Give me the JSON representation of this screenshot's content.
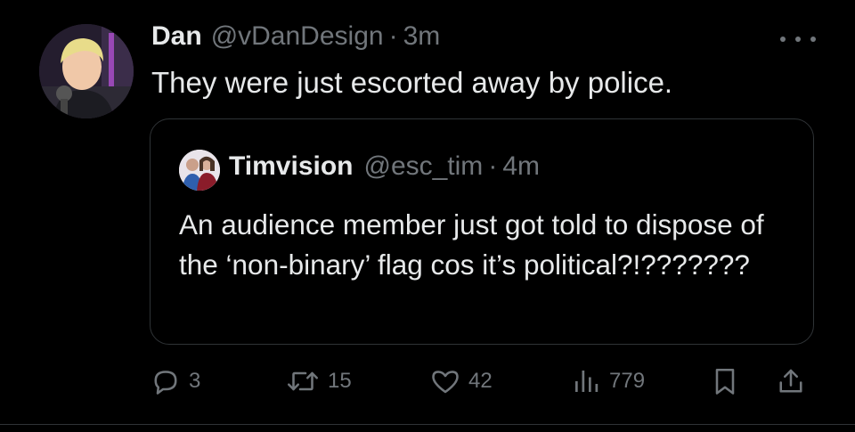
{
  "tweet": {
    "author": {
      "name": "Dan",
      "handle": "@vDanDesign",
      "separator": "·",
      "time": "3m"
    },
    "text": "They were just escorted away by police.",
    "quoted": {
      "name": "Timvision",
      "handle": "@esc_tim",
      "separator": "·",
      "time": "4m",
      "text": "An audience member just got told to dispose of the ‘non-binary’ flag cos it’s political?!???????"
    },
    "actions": {
      "reply": {
        "icon": "reply-icon",
        "count": "3"
      },
      "retweet": {
        "icon": "retweet-icon",
        "count": "15"
      },
      "like": {
        "icon": "heart-icon",
        "count": "42"
      },
      "views": {
        "icon": "views-icon",
        "count": "779"
      },
      "bookmark": {
        "icon": "bookmark-icon"
      },
      "share": {
        "icon": "share-icon"
      }
    }
  },
  "colors": {
    "background": "#000000",
    "primary_text": "#e7e9ea",
    "secondary_text": "#71767b",
    "border": "#2f3336"
  }
}
